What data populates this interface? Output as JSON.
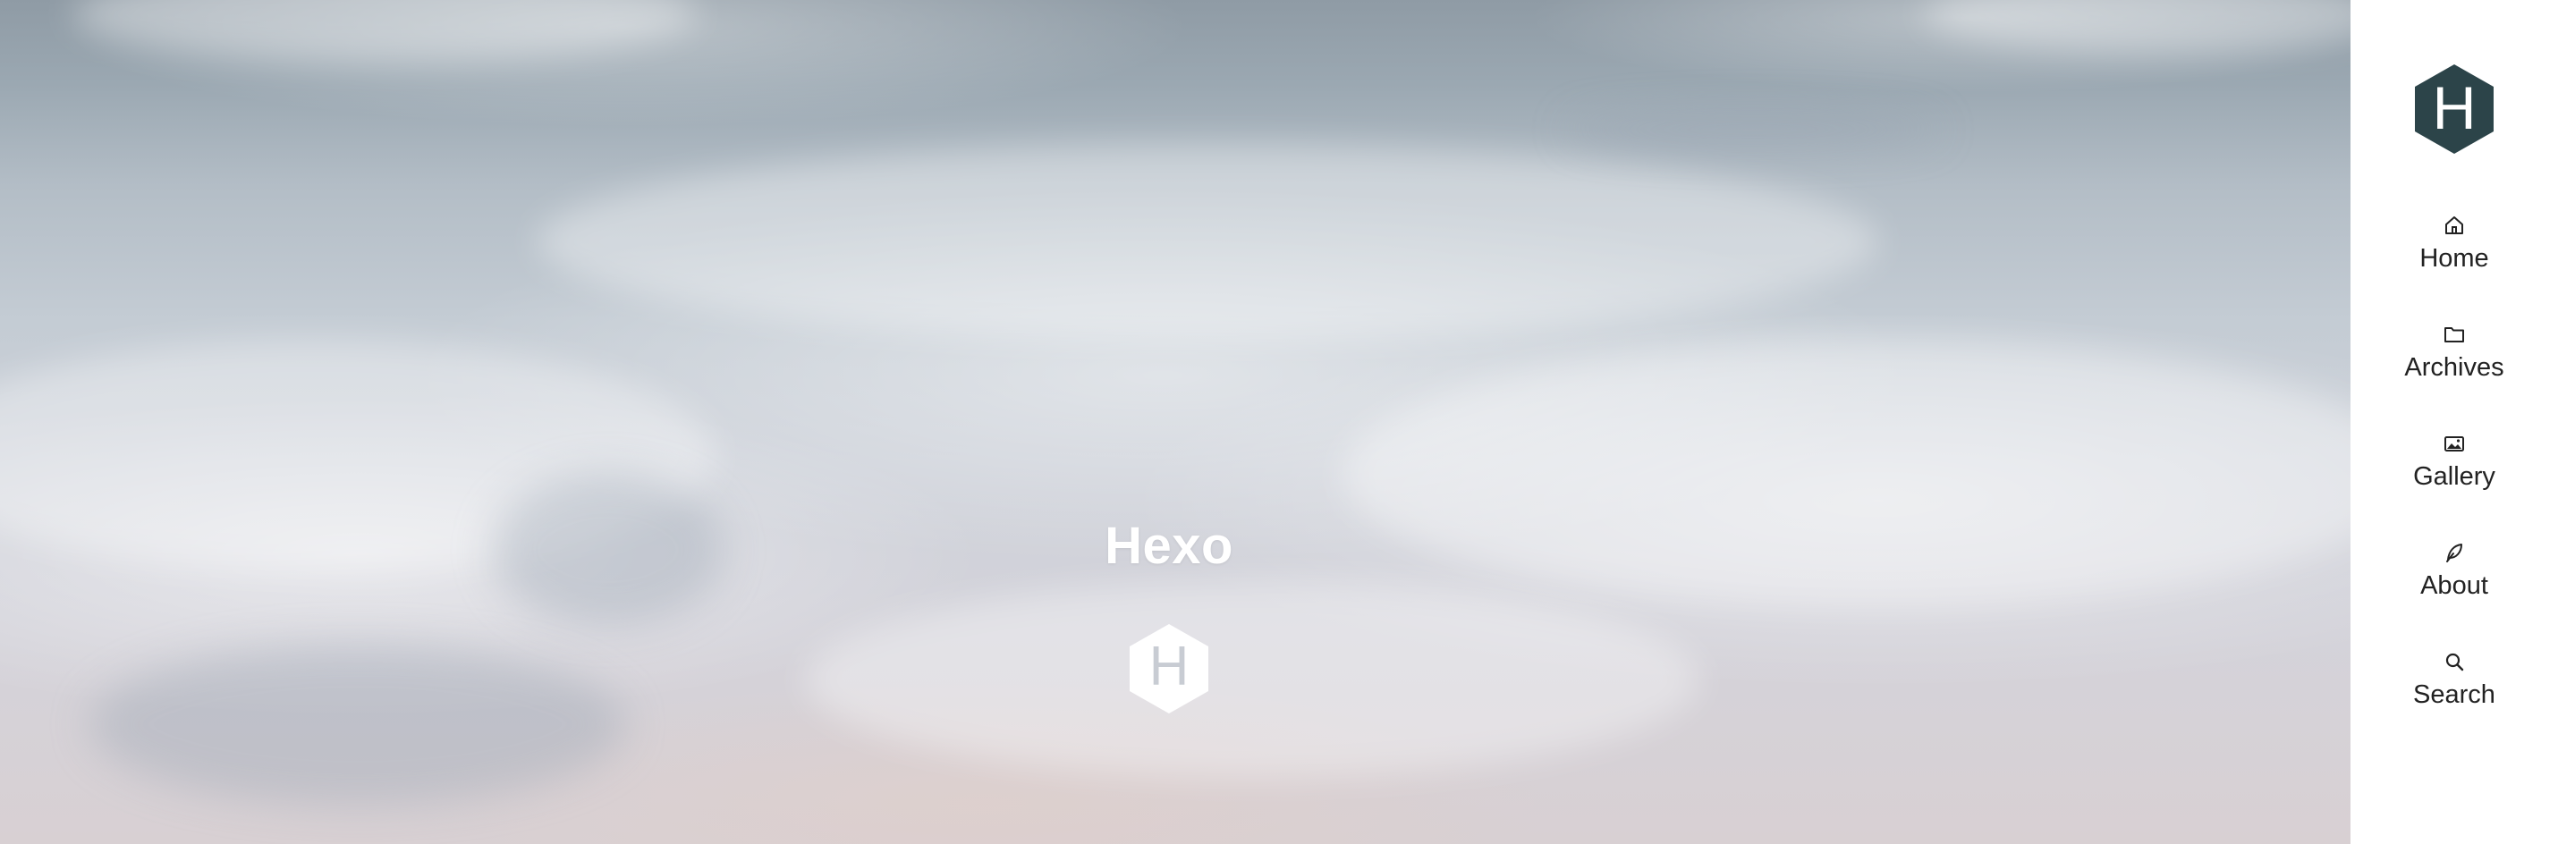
{
  "hero": {
    "title": "Hexo",
    "logo_letter": "H"
  },
  "sidebar": {
    "logo_letter": "H",
    "items": [
      {
        "label": "Home",
        "icon": "home-icon"
      },
      {
        "label": "Archives",
        "icon": "folder-icon"
      },
      {
        "label": "Gallery",
        "icon": "image-icon"
      },
      {
        "label": "About",
        "icon": "leaf-icon"
      },
      {
        "label": "Search",
        "icon": "search-icon"
      }
    ]
  },
  "colors": {
    "sidebar_logo": "#2c4449",
    "hero_logo": "#ffffff",
    "nav_text": "#222222"
  }
}
